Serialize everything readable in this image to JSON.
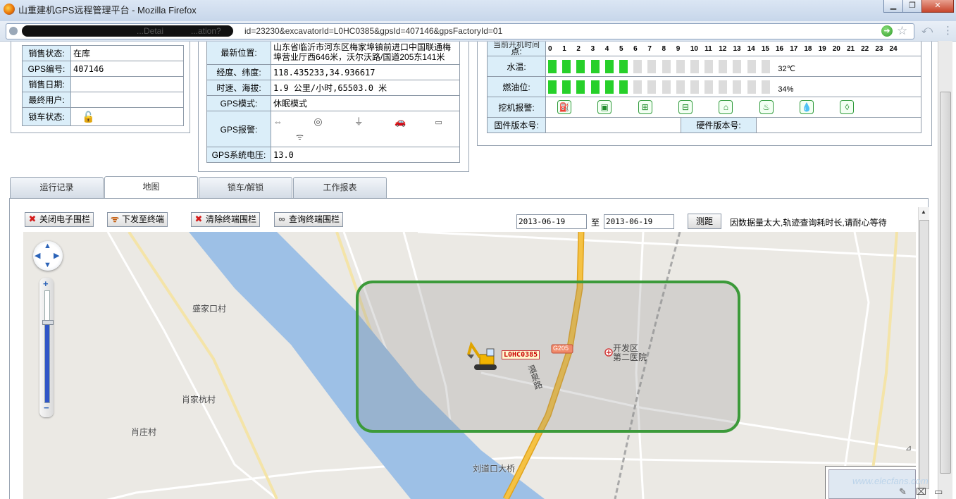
{
  "window": {
    "title": "山重建机GPS远程管理平台 - Mozilla Firefox",
    "url": "id=23230&excavatorId=L0HC0385&gpsId=407146&gpsFactoryId=01",
    "url_visible_fragments": [
      "...Detai",
      "...ation?"
    ],
    "controls": [
      "minimize",
      "maximize",
      "close"
    ]
  },
  "sales_panel": {
    "rows": [
      {
        "label": "销售状态:",
        "value": "在库"
      },
      {
        "label": "GPS编号:",
        "value": "407146"
      },
      {
        "label": "销售日期:",
        "value": ""
      },
      {
        "label": "最终用户:",
        "value": ""
      },
      {
        "label": "锁车状态:",
        "value": "",
        "icon": "unlocked-padlock-icon"
      }
    ]
  },
  "gps_panel": {
    "location_label": "最新位置:",
    "location_value": "山东省临沂市河东区梅家埠镇前进口中国联通梅埠营业厅西646米，沃尔沃路/国道205东141米",
    "coords_label": "经度、纬度:",
    "coords_value": "118.435233,34.936617",
    "speed_label": "时速、海拔:",
    "speed_value": "1.9  公里/小时,65503.0  米",
    "mode_label": "GPS模式:",
    "mode_value": "休眠模式",
    "alarm_label": "GPS报警:",
    "alarm_icons": [
      "arrows-icon",
      "target-icon",
      "plug-icon",
      "car-icon",
      "battery-icon",
      "antenna-icon"
    ],
    "voltage_label": "GPS系统电压:",
    "voltage_value": "13.0"
  },
  "machine_panel": {
    "hours_label": "点:",
    "hours_label_top": "当前开机时间",
    "hours": [
      "0",
      "1",
      "2",
      "3",
      "4",
      "5",
      "6",
      "7",
      "8",
      "9",
      "10",
      "11",
      "12",
      "13",
      "14",
      "15",
      "16",
      "17",
      "18",
      "19",
      "20",
      "21",
      "22",
      "23",
      "24"
    ],
    "water_temp_label": "水温:",
    "water_temp_level": 0.375,
    "water_temp_value": "32℃",
    "fuel_label": "燃油位:",
    "fuel_level": 0.375,
    "fuel_value": "34%",
    "excavator_alarm_label": "挖机报警:",
    "excavator_alarm_icons": [
      "fuel-pump-icon",
      "oil-can-icon",
      "filter-icon",
      "battery-icon",
      "engine-oil-icon",
      "coolant-icon",
      "water-drop-icon",
      "oil-drop-icon"
    ],
    "firmware_label": "固件版本号:",
    "firmware_value": "",
    "hardware_label": "硬件版本号:",
    "hardware_value": ""
  },
  "tabs": [
    {
      "label": "运行记录",
      "active": false
    },
    {
      "label": "地图",
      "active": true
    },
    {
      "label": "锁车/解锁",
      "active": false
    },
    {
      "label": "工作报表",
      "active": false
    }
  ],
  "toolbar": {
    "close_fence": "关闭电子围栏",
    "send_to_terminal": "下发至终端",
    "clear_fence": "清除终端围栏",
    "query_fence": "查询终端围栏",
    "date_from": "2013-06-19",
    "date_sep": "至",
    "date_to": "2013-06-19",
    "measure": "测距",
    "notice": "因数据量太大,轨迹查询耗时长,请耐心等待"
  },
  "map": {
    "labels": {
      "village1": "盛家口村",
      "village2": "肖家杭村",
      "village3": "肖庄村",
      "hospital": "开发区第二医院",
      "hospital_line1": "开发区",
      "hospital_line2": "第二医院",
      "road_shield": "G205",
      "road_name": "温泉路",
      "bridge": "刘道口大桥"
    },
    "vehicle_label": "L0HC0385",
    "zoom_level": 0.72,
    "fence_color": "#3c9a3a",
    "river_color": "#9dc0e6",
    "road_color": "#f5c243"
  },
  "watermark": "www.elecfans.com"
}
